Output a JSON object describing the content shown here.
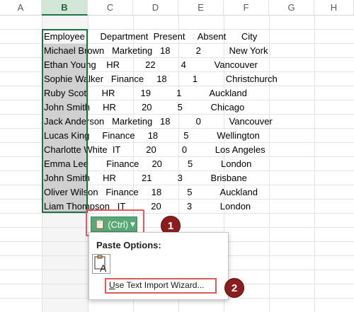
{
  "columns": [
    "A",
    "B",
    "C",
    "D",
    "E",
    "F",
    "G",
    "H"
  ],
  "selected_column": "B",
  "rows": [
    "Employee      Department  Present     Absent      City",
    "Michael Brown   Marketing   18          2           New York",
    "Ethan Young    HR          22          4           Vancouver",
    "Sophie Walker   Finance     18          1           Christchurch",
    "Ruby Scot      HR          19          1           Auckland",
    "John Smith     HR          20          5           Chicago",
    "Jack Anderson   Marketing   18          0           Vancouver",
    "Lucas King     Finance     18          5           Wellington",
    "Charlotte White  IT          20          0           Los Angeles",
    "Emma Lee       Finance     20          5           London",
    "John Smith     HR          21          3           Brisbane",
    "Oliver Wilson   Finance     18          5           Auckland",
    "Liam Thompson   IT          20          3           London"
  ],
  "paste_button": {
    "label": "(Ctrl)",
    "arrow": "▾"
  },
  "popup": {
    "title": "Paste Options:",
    "wizard_label_u": "U",
    "wizard_label_rest": "se Text Import Wizard..."
  },
  "badges": {
    "one": "1",
    "two": "2"
  },
  "colors": {
    "accent": "#1e7145",
    "highlight": "#e05a5a",
    "badge": "#8b1d1d"
  }
}
